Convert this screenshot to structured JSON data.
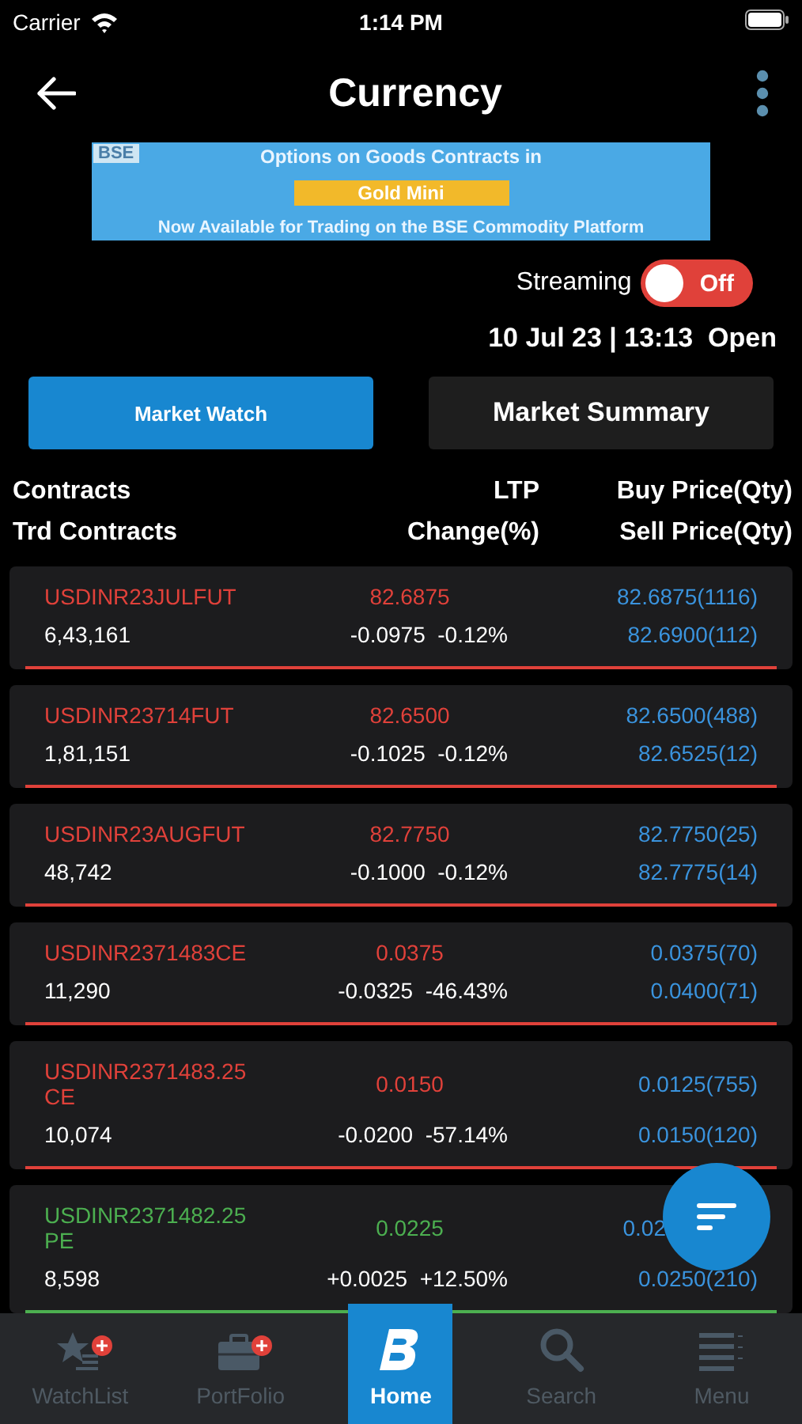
{
  "status_bar": {
    "carrier": "Carrier",
    "time": "1:14 PM"
  },
  "header": {
    "title": "Currency"
  },
  "banner": {
    "logo": "BSE",
    "line_1": "Options on Goods Contracts in",
    "highlight": "Gold Mini",
    "line_2": "Now Available for Trading on the BSE Commodity Platform"
  },
  "streaming": {
    "label": "Streaming",
    "on": false,
    "state_text": "Off"
  },
  "market_status": "10 Jul 23 | 13:13  Open",
  "tabs": [
    {
      "label": "Market Watch",
      "selected": true
    },
    {
      "label": "Market Summary",
      "selected": false
    }
  ],
  "columns": {
    "contracts": "Contracts",
    "ltp": "LTP",
    "buy": "Buy Price(Qty)",
    "trd_contracts": "Trd Contracts",
    "change": "Change(%)",
    "sell": "Sell Price(Qty)"
  },
  "rows": [
    {
      "contract": "USDINR23JULFUT",
      "color": "#e0413a",
      "ltp": "82.6875",
      "buy": "82.6875(1116)",
      "trd": "6,43,161",
      "change": "-0.0975",
      "change_pct": "-0.12%",
      "sell": "82.6900(112)"
    },
    {
      "contract": "USDINR23714FUT",
      "color": "#e0413a",
      "ltp": "82.6500",
      "buy": "82.6500(488)",
      "trd": "1,81,151",
      "change": "-0.1025",
      "change_pct": "-0.12%",
      "sell": "82.6525(12)"
    },
    {
      "contract": "USDINR23AUGFUT",
      "color": "#e0413a",
      "ltp": "82.7750",
      "buy": "82.7750(25)",
      "trd": "48,742",
      "change": "-0.1000",
      "change_pct": "-0.12%",
      "sell": "82.7775(14)"
    },
    {
      "contract": "USDINR2371483CE",
      "color": "#e0413a",
      "ltp": "0.0375",
      "buy": "0.0375(70)",
      "trd": "11,290",
      "change": "-0.0325",
      "change_pct": "-46.43%",
      "sell": "0.0400(71)"
    },
    {
      "contract": "USDINR2371483.25 CE",
      "color": "#e0413a",
      "ltp": "0.0150",
      "buy": "0.0125(755)",
      "trd": "10,074",
      "change": "-0.0200",
      "change_pct": "-57.14%",
      "sell": "0.0150(120)"
    },
    {
      "contract": "USDINR2371482.25 PE",
      "color": "#4caf50",
      "ltp": "0.0225",
      "buy": "0.02",
      "trd": "8,598",
      "change": "+0.0025",
      "change_pct": "+12.50%",
      "sell": "0.0250(210)"
    }
  ],
  "bottom_nav": [
    {
      "label": "WatchList",
      "kind": "watchlist",
      "selected": false,
      "badge": true
    },
    {
      "label": "PortFolio",
      "kind": "portfolio",
      "selected": false,
      "badge": true
    },
    {
      "label": "Home",
      "kind": "home",
      "selected": true,
      "badge": false
    },
    {
      "label": "Search",
      "kind": "search",
      "selected": false,
      "badge": false
    },
    {
      "label": "Menu",
      "kind": "menu",
      "selected": false,
      "badge": false
    }
  ]
}
